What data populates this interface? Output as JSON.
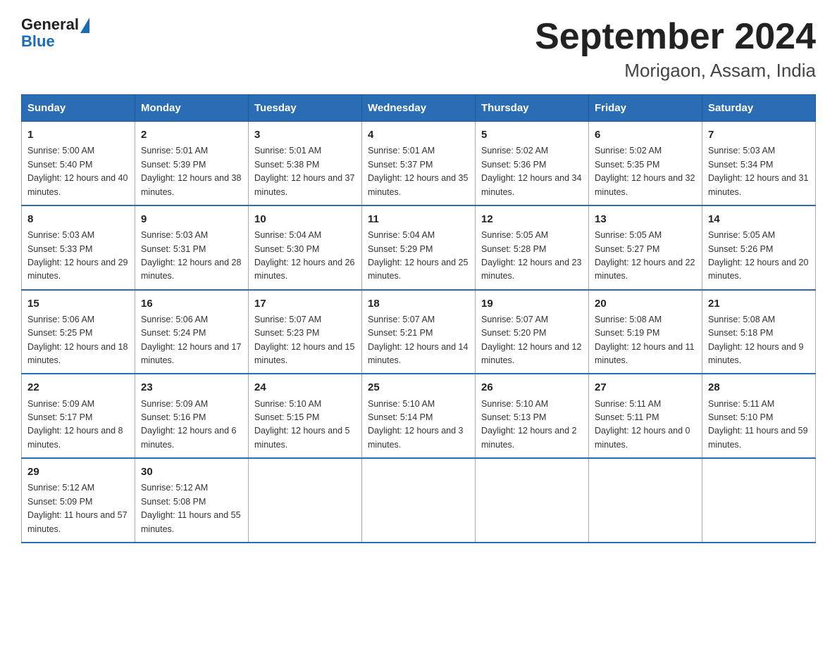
{
  "header": {
    "logo_general": "General",
    "logo_blue": "Blue",
    "title": "September 2024",
    "subtitle": "Morigaon, Assam, India"
  },
  "weekdays": [
    "Sunday",
    "Monday",
    "Tuesday",
    "Wednesday",
    "Thursday",
    "Friday",
    "Saturday"
  ],
  "weeks": [
    [
      {
        "day": "1",
        "sunrise": "5:00 AM",
        "sunset": "5:40 PM",
        "daylight": "12 hours and 40 minutes."
      },
      {
        "day": "2",
        "sunrise": "5:01 AM",
        "sunset": "5:39 PM",
        "daylight": "12 hours and 38 minutes."
      },
      {
        "day": "3",
        "sunrise": "5:01 AM",
        "sunset": "5:38 PM",
        "daylight": "12 hours and 37 minutes."
      },
      {
        "day": "4",
        "sunrise": "5:01 AM",
        "sunset": "5:37 PM",
        "daylight": "12 hours and 35 minutes."
      },
      {
        "day": "5",
        "sunrise": "5:02 AM",
        "sunset": "5:36 PM",
        "daylight": "12 hours and 34 minutes."
      },
      {
        "day": "6",
        "sunrise": "5:02 AM",
        "sunset": "5:35 PM",
        "daylight": "12 hours and 32 minutes."
      },
      {
        "day": "7",
        "sunrise": "5:03 AM",
        "sunset": "5:34 PM",
        "daylight": "12 hours and 31 minutes."
      }
    ],
    [
      {
        "day": "8",
        "sunrise": "5:03 AM",
        "sunset": "5:33 PM",
        "daylight": "12 hours and 29 minutes."
      },
      {
        "day": "9",
        "sunrise": "5:03 AM",
        "sunset": "5:31 PM",
        "daylight": "12 hours and 28 minutes."
      },
      {
        "day": "10",
        "sunrise": "5:04 AM",
        "sunset": "5:30 PM",
        "daylight": "12 hours and 26 minutes."
      },
      {
        "day": "11",
        "sunrise": "5:04 AM",
        "sunset": "5:29 PM",
        "daylight": "12 hours and 25 minutes."
      },
      {
        "day": "12",
        "sunrise": "5:05 AM",
        "sunset": "5:28 PM",
        "daylight": "12 hours and 23 minutes."
      },
      {
        "day": "13",
        "sunrise": "5:05 AM",
        "sunset": "5:27 PM",
        "daylight": "12 hours and 22 minutes."
      },
      {
        "day": "14",
        "sunrise": "5:05 AM",
        "sunset": "5:26 PM",
        "daylight": "12 hours and 20 minutes."
      }
    ],
    [
      {
        "day": "15",
        "sunrise": "5:06 AM",
        "sunset": "5:25 PM",
        "daylight": "12 hours and 18 minutes."
      },
      {
        "day": "16",
        "sunrise": "5:06 AM",
        "sunset": "5:24 PM",
        "daylight": "12 hours and 17 minutes."
      },
      {
        "day": "17",
        "sunrise": "5:07 AM",
        "sunset": "5:23 PM",
        "daylight": "12 hours and 15 minutes."
      },
      {
        "day": "18",
        "sunrise": "5:07 AM",
        "sunset": "5:21 PM",
        "daylight": "12 hours and 14 minutes."
      },
      {
        "day": "19",
        "sunrise": "5:07 AM",
        "sunset": "5:20 PM",
        "daylight": "12 hours and 12 minutes."
      },
      {
        "day": "20",
        "sunrise": "5:08 AM",
        "sunset": "5:19 PM",
        "daylight": "12 hours and 11 minutes."
      },
      {
        "day": "21",
        "sunrise": "5:08 AM",
        "sunset": "5:18 PM",
        "daylight": "12 hours and 9 minutes."
      }
    ],
    [
      {
        "day": "22",
        "sunrise": "5:09 AM",
        "sunset": "5:17 PM",
        "daylight": "12 hours and 8 minutes."
      },
      {
        "day": "23",
        "sunrise": "5:09 AM",
        "sunset": "5:16 PM",
        "daylight": "12 hours and 6 minutes."
      },
      {
        "day": "24",
        "sunrise": "5:10 AM",
        "sunset": "5:15 PM",
        "daylight": "12 hours and 5 minutes."
      },
      {
        "day": "25",
        "sunrise": "5:10 AM",
        "sunset": "5:14 PM",
        "daylight": "12 hours and 3 minutes."
      },
      {
        "day": "26",
        "sunrise": "5:10 AM",
        "sunset": "5:13 PM",
        "daylight": "12 hours and 2 minutes."
      },
      {
        "day": "27",
        "sunrise": "5:11 AM",
        "sunset": "5:11 PM",
        "daylight": "12 hours and 0 minutes."
      },
      {
        "day": "28",
        "sunrise": "5:11 AM",
        "sunset": "5:10 PM",
        "daylight": "11 hours and 59 minutes."
      }
    ],
    [
      {
        "day": "29",
        "sunrise": "5:12 AM",
        "sunset": "5:09 PM",
        "daylight": "11 hours and 57 minutes."
      },
      {
        "day": "30",
        "sunrise": "5:12 AM",
        "sunset": "5:08 PM",
        "daylight": "11 hours and 55 minutes."
      },
      null,
      null,
      null,
      null,
      null
    ]
  ],
  "labels": {
    "sunrise_prefix": "Sunrise: ",
    "sunset_prefix": "Sunset: ",
    "daylight_prefix": "Daylight: "
  }
}
